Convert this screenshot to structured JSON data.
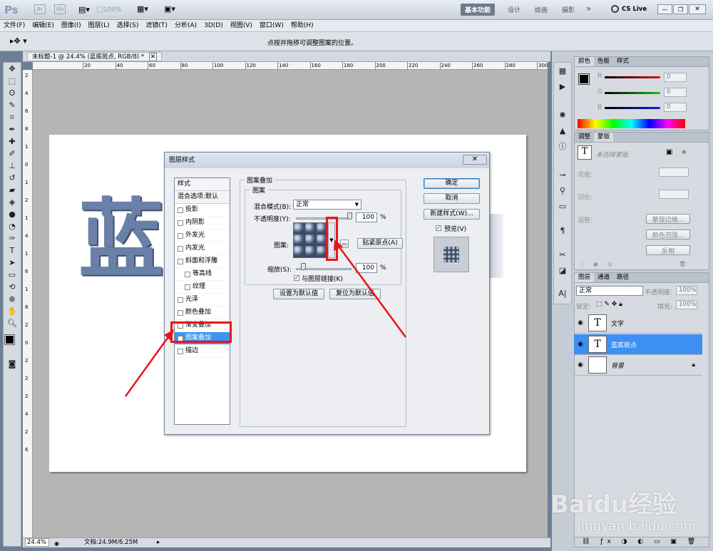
{
  "app": {
    "logo": "Ps",
    "zoom": "100%",
    "workspace": "基本功能",
    "ws_design": "设计",
    "ws_paint": "绘画",
    "ws_photo": "摄影",
    "more": "»",
    "cslive": "CS Live"
  },
  "menu": [
    "文件(F)",
    "编辑(E)",
    "图像(I)",
    "图层(L)",
    "选择(S)",
    "滤镜(T)",
    "分析(A)",
    "3D(D)",
    "视图(V)",
    "窗口(W)",
    "帮助(H)"
  ],
  "options": {
    "hint": "点按并拖移可调整图案的位置。"
  },
  "doc": {
    "tab": "未标题-1 @ 24.4% (蓝底斑点, RGB/8) *",
    "big_text": "蓝",
    "zoom": "24.4%",
    "docsize": "文档:24.9M/6.25M",
    "ruler_h": [
      "20",
      "40",
      "60",
      "80",
      "100",
      "120",
      "140",
      "160",
      "180",
      "200",
      "220",
      "240",
      "260",
      "280",
      "300"
    ],
    "ruler_v": [
      "2",
      "4",
      "6",
      "8",
      "1",
      "0",
      "1",
      "2",
      "1",
      "4",
      "1",
      "6",
      "1",
      "8",
      "2",
      "0",
      "2",
      "2",
      "2",
      "4",
      "2",
      "6"
    ]
  },
  "panels": {
    "color_tabs": [
      "颜色",
      "色板",
      "样式"
    ],
    "color_r": "R",
    "color_g": "G",
    "color_b": "B",
    "color_values": [
      "0",
      "0",
      "0"
    ],
    "adj_tabs": [
      "调整",
      "蒙版"
    ],
    "mask_none": "未选择蒙版",
    "density": "浓度:",
    "feather": "羽化:",
    "refine": "调整:",
    "mask_edge": "蒙版边缘...",
    "color_range": "颜色范围...",
    "invert": "反相",
    "layer_tabs": [
      "图层",
      "通道",
      "路径"
    ],
    "blend": "正常",
    "opacity_label": "不透明度:",
    "opacity": "100%",
    "lock": "锁定:",
    "fill_label": "填充:",
    "fill": "100%",
    "layers": [
      {
        "name": "文字",
        "thumb": "T"
      },
      {
        "name": "蓝底斑点",
        "thumb": "T"
      },
      {
        "name": "背景",
        "thumb": ""
      }
    ]
  },
  "dialog": {
    "title": "图层样式",
    "styles_header": "样式",
    "blend_default": "混合选项:默认",
    "items": [
      {
        "label": "投影",
        "checked": false,
        "indent": false
      },
      {
        "label": "内阴影",
        "checked": false,
        "indent": false
      },
      {
        "label": "外发光",
        "checked": false,
        "indent": false
      },
      {
        "label": "内发光",
        "checked": false,
        "indent": false
      },
      {
        "label": "斜面和浮雕",
        "checked": false,
        "indent": false
      },
      {
        "label": "等高线",
        "checked": false,
        "indent": true
      },
      {
        "label": "纹理",
        "checked": false,
        "indent": true
      },
      {
        "label": "光泽",
        "checked": false,
        "indent": false
      },
      {
        "label": "颜色叠加",
        "checked": false,
        "indent": false
      },
      {
        "label": "渐变叠加",
        "checked": false,
        "indent": false
      },
      {
        "label": "图案叠加",
        "checked": true,
        "indent": false
      },
      {
        "label": "描边",
        "checked": false,
        "indent": false
      }
    ],
    "section": "图案叠加",
    "subsection": "图案",
    "blend_mode_label": "混合模式(B):",
    "blend_mode": "正常",
    "opacity_label": "不透明度(Y):",
    "opacity": "100",
    "opacity_pct": 1.0,
    "pattern_label": "图案:",
    "snap_origin": "贴紧原点(A)",
    "scale_label": "缩放(S):",
    "scale": "100",
    "scale_pct": 0.1,
    "link_layer": "与图层链接(K)",
    "link_checked": true,
    "set_default": "设置为默认值",
    "reset_default": "复位为默认值",
    "ok": "确定",
    "cancel": "取消",
    "new_style": "新建样式(W)...",
    "preview": "预览(V)",
    "preview_checked": true,
    "percent": "%"
  },
  "watermark": {
    "brand": "Baidu经验",
    "url": "jingyan.baidu.com"
  }
}
